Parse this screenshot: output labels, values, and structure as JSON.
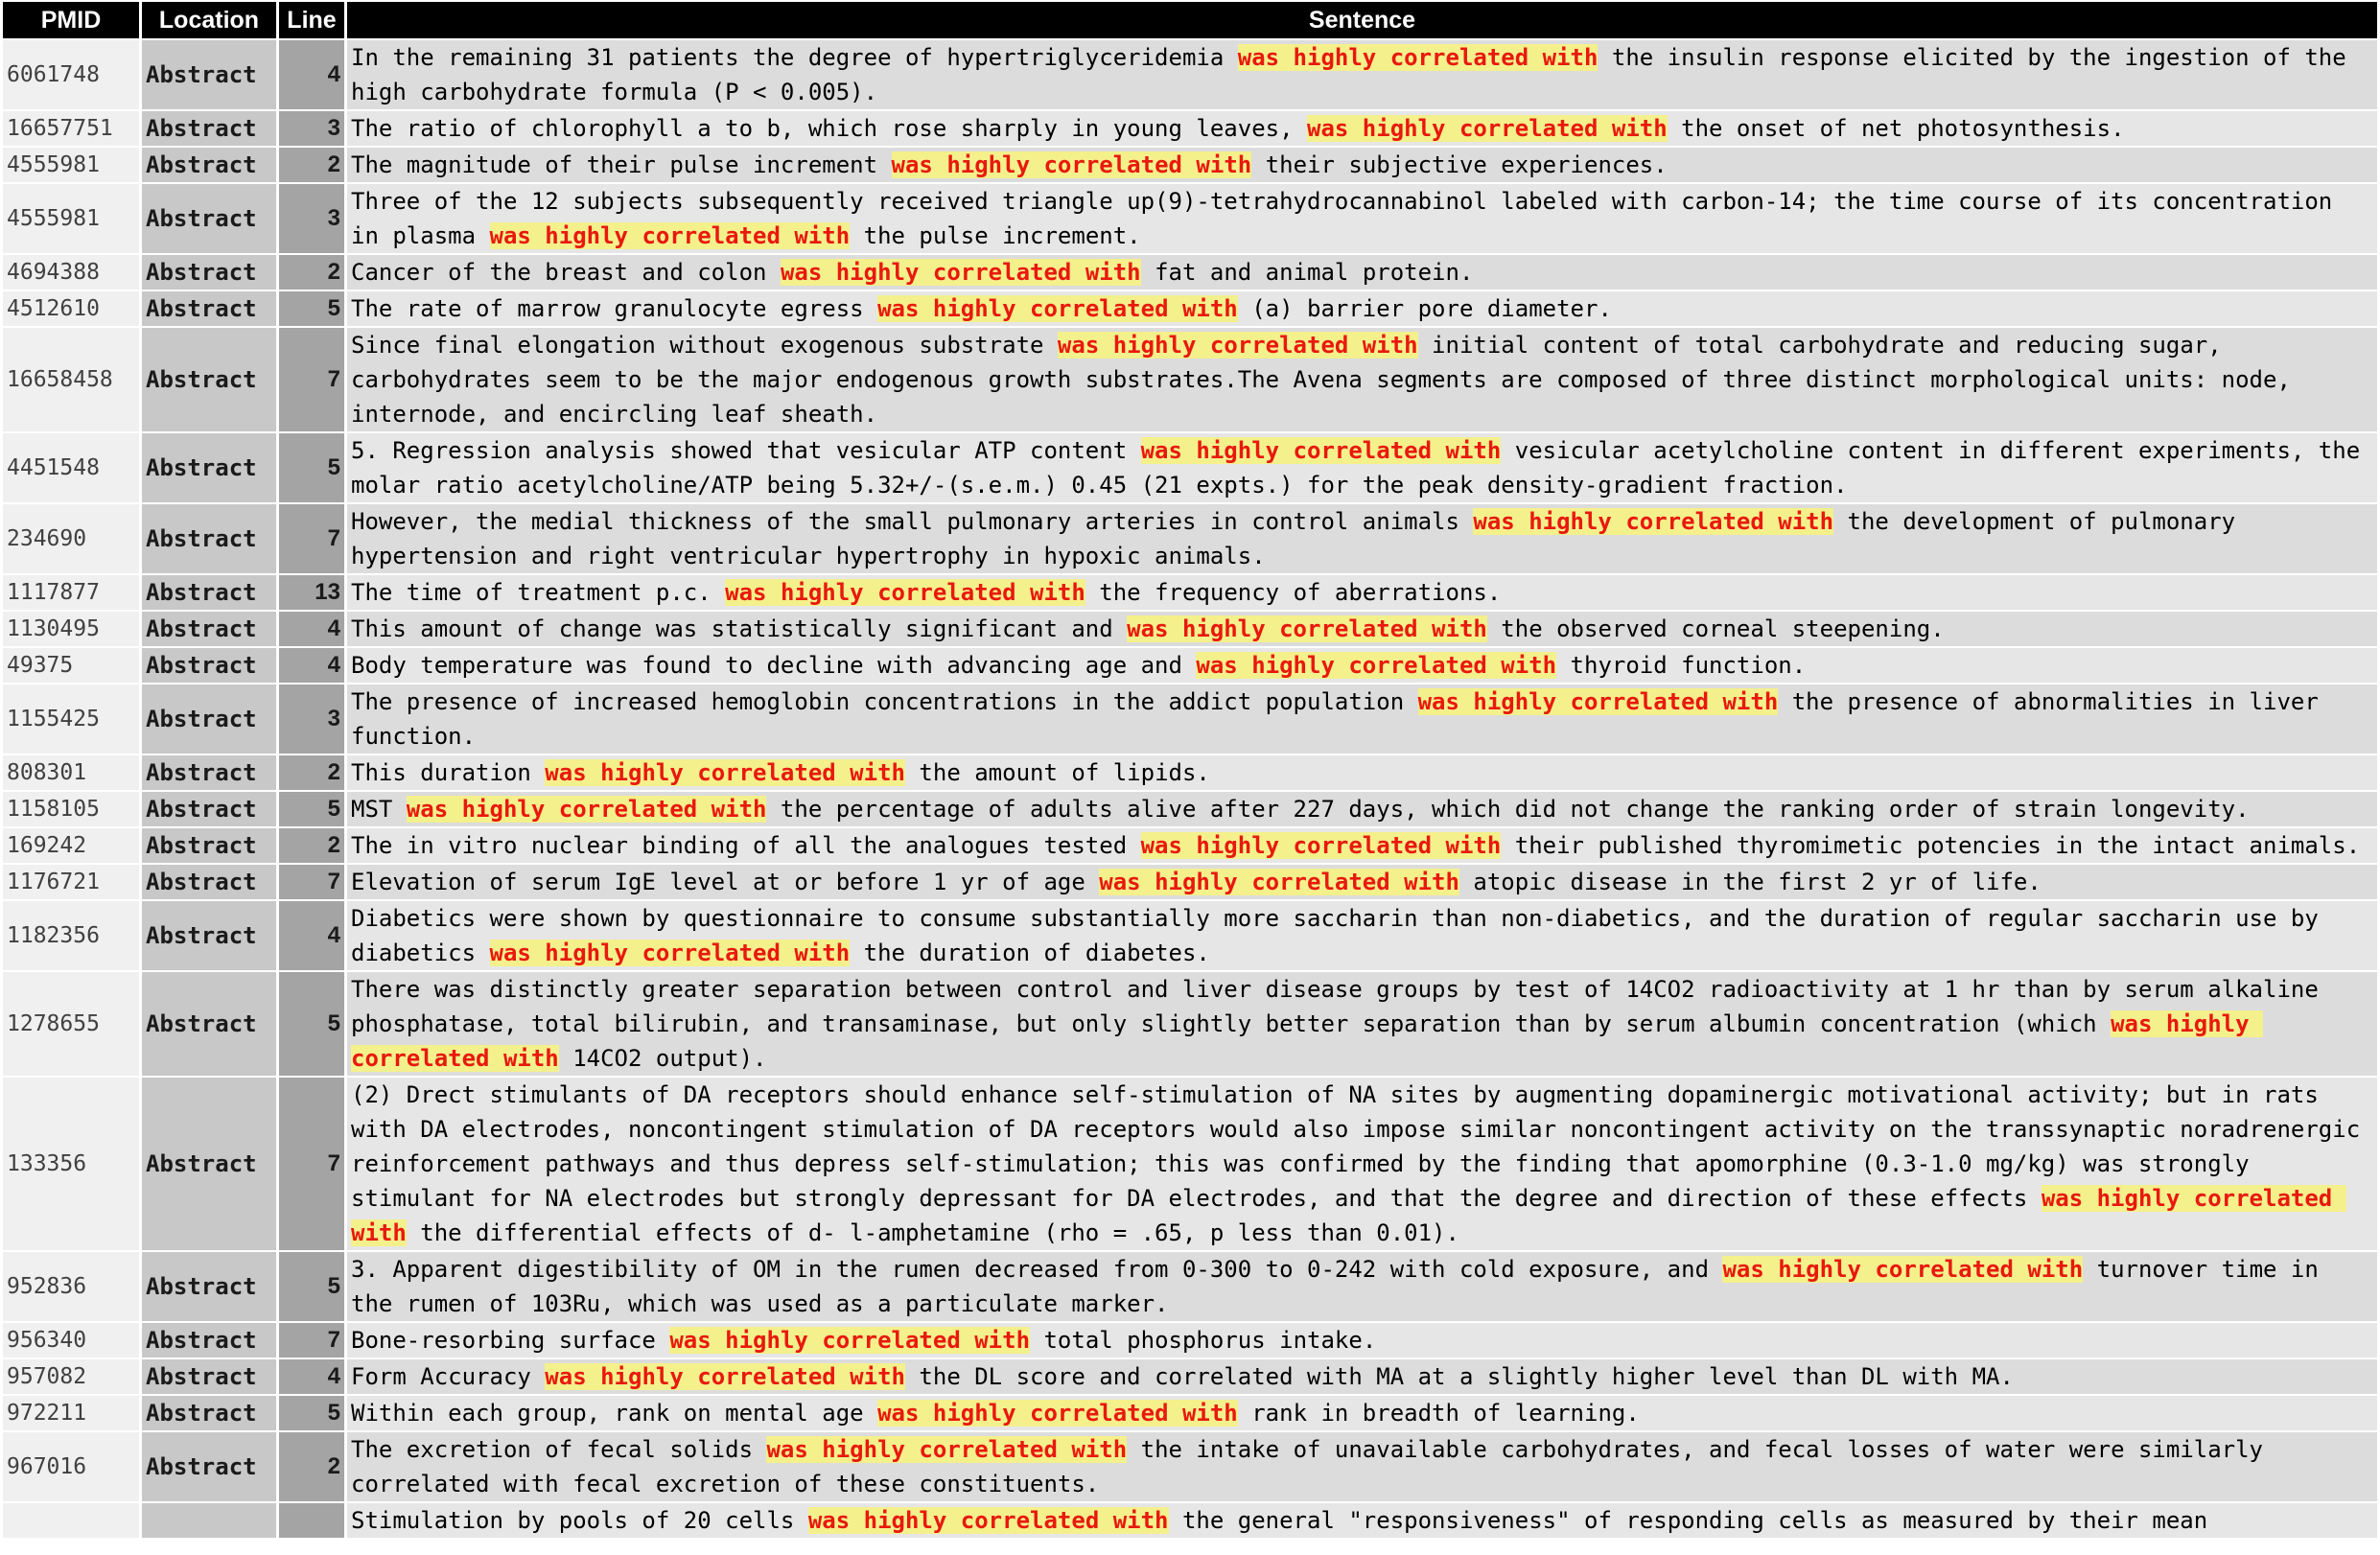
{
  "headers": {
    "pmid": "PMID",
    "location": "Location",
    "line": "Line",
    "sentence": "Sentence"
  },
  "colors": {
    "header_bg": "#000000",
    "highlight_bg": "#f4f08c",
    "highlight_text": "#e8190e"
  },
  "rows": [
    {
      "pmid": "6061748",
      "location": "Abstract",
      "line": "4",
      "before": "In the remaining 31 patients the degree of hypertriglyceridemia ",
      "match": "was highly correlated with",
      "after": " the insulin response elicited by the ingestion of the high carbohydrate formula (P < 0.005)."
    },
    {
      "pmid": "16657751",
      "location": "Abstract",
      "line": "3",
      "before": "The ratio of chlorophyll a to b, which rose sharply in young leaves, ",
      "match": "was highly correlated with",
      "after": " the onset of net photosynthesis."
    },
    {
      "pmid": "4555981",
      "location": "Abstract",
      "line": "2",
      "before": "The magnitude of their pulse increment ",
      "match": "was highly correlated with",
      "after": " their subjective experiences."
    },
    {
      "pmid": "4555981",
      "location": "Abstract",
      "line": "3",
      "before": "Three of the 12 subjects subsequently received triangle up(9)-tetrahydrocannabinol labeled with carbon-14; the time course of its concentration in plasma ",
      "match": "was highly correlated with",
      "after": " the pulse increment."
    },
    {
      "pmid": "4694388",
      "location": "Abstract",
      "line": "2",
      "before": "Cancer of the breast and colon ",
      "match": "was highly correlated with",
      "after": " fat and animal protein."
    },
    {
      "pmid": "4512610",
      "location": "Abstract",
      "line": "5",
      "before": "The rate of marrow granulocyte egress ",
      "match": "was highly correlated with",
      "after": " (a) barrier pore diameter."
    },
    {
      "pmid": "16658458",
      "location": "Abstract",
      "line": "7",
      "before": "Since final elongation without exogenous substrate ",
      "match": "was highly correlated with",
      "after": " initial content of total carbohydrate and reducing sugar, carbohydrates seem to be the major endogenous growth substrates.The Avena segments are composed of three distinct morphological units: node, internode, and encircling leaf sheath."
    },
    {
      "pmid": "4451548",
      "location": "Abstract",
      "line": "5",
      "before": "5. Regression analysis showed that vesicular ATP content ",
      "match": "was highly correlated with",
      "after": " vesicular acetylcholine content in different experiments, the molar ratio acetylcholine/ATP being 5.32+/-(s.e.m.) 0.45 (21 expts.) for the peak density-gradient fraction."
    },
    {
      "pmid": "234690",
      "location": "Abstract",
      "line": "7",
      "before": "However, the medial thickness of the small pulmonary arteries in control animals ",
      "match": "was highly correlated with",
      "after": " the development of pulmonary hypertension and right ventricular hypertrophy in hypoxic animals."
    },
    {
      "pmid": "1117877",
      "location": "Abstract",
      "line": "13",
      "before": "The time of treatment p.c. ",
      "match": "was highly correlated with",
      "after": " the frequency of aberrations."
    },
    {
      "pmid": "1130495",
      "location": "Abstract",
      "line": "4",
      "before": "This amount of change was statistically significant and ",
      "match": "was highly correlated with",
      "after": " the observed corneal steepening."
    },
    {
      "pmid": "49375",
      "location": "Abstract",
      "line": "4",
      "before": "Body temperature was found to decline with advancing age and ",
      "match": "was highly correlated with",
      "after": " thyroid function."
    },
    {
      "pmid": "1155425",
      "location": "Abstract",
      "line": "3",
      "before": "The presence of increased hemoglobin concentrations in the addict population ",
      "match": "was highly correlated with",
      "after": " the presence of abnormalities in liver function."
    },
    {
      "pmid": "808301",
      "location": "Abstract",
      "line": "2",
      "before": "This duration ",
      "match": "was highly correlated with",
      "after": " the amount of lipids."
    },
    {
      "pmid": "1158105",
      "location": "Abstract",
      "line": "5",
      "before": "MST ",
      "match": "was highly correlated with",
      "after": " the percentage of adults alive after 227 days, which did not change the ranking order of strain longevity."
    },
    {
      "pmid": "169242",
      "location": "Abstract",
      "line": "2",
      "before": "The in vitro nuclear binding of all the analogues tested ",
      "match": "was highly correlated with",
      "after": " their published thyromimetic potencies in the intact animals."
    },
    {
      "pmid": "1176721",
      "location": "Abstract",
      "line": "7",
      "before": "Elevation of serum IgE level at or before 1 yr of age ",
      "match": "was highly correlated with",
      "after": " atopic disease in the first 2 yr of life."
    },
    {
      "pmid": "1182356",
      "location": "Abstract",
      "line": "4",
      "before": "Diabetics were shown by questionnaire to consume substantially more saccharin than non-diabetics, and the duration of regular saccharin use by diabetics ",
      "match": "was highly correlated with",
      "after": " the duration of diabetes."
    },
    {
      "pmid": "1278655",
      "location": "Abstract",
      "line": "5",
      "before": "There was distinctly greater separation between control and liver disease groups by test of 14CO2 radioactivity at 1 hr than by serum alkaline phosphatase, total bilirubin, and transaminase, but only slightly better separation than by serum albumin concentration (which ",
      "match": "was highly correlated with",
      "after": " 14CO2 output)."
    },
    {
      "pmid": "133356",
      "location": "Abstract",
      "line": "7",
      "before": "(2) Drect stimulants of DA receptors should enhance self-stimulation of NA sites by augmenting dopaminergic motivational activity; but in rats with DA electrodes, noncontingent stimulation of DA receptors would also impose similar noncontingent activity on the transsynaptic noradrenergic reinforcement pathways and thus depress self-stimulation; this was confirmed by the finding that apomorphine (0.3-1.0 mg/kg) was strongly stimulant for NA electrodes but strongly depressant for DA electrodes, and that the degree and direction of these effects ",
      "match": "was highly correlated with",
      "after": " the differential effects of d- l-amphetamine (rho = .65, p less than 0.01)."
    },
    {
      "pmid": "952836",
      "location": "Abstract",
      "line": "5",
      "before": "3. Apparent digestibility of OM in the rumen decreased from 0-300 to 0-242 with cold exposure, and ",
      "match": "was highly correlated with",
      "after": " turnover time in the rumen of 103Ru, which was used as a particulate marker."
    },
    {
      "pmid": "956340",
      "location": "Abstract",
      "line": "7",
      "before": "Bone-resorbing surface ",
      "match": "was highly correlated with",
      "after": " total phosphorus intake."
    },
    {
      "pmid": "957082",
      "location": "Abstract",
      "line": "4",
      "before": "Form Accuracy ",
      "match": "was highly correlated with",
      "after": " the DL score and correlated with MA at a slightly higher level than DL with MA."
    },
    {
      "pmid": "972211",
      "location": "Abstract",
      "line": "5",
      "before": "Within each group, rank on mental age ",
      "match": "was highly correlated with",
      "after": " rank in breadth of learning."
    },
    {
      "pmid": "967016",
      "location": "Abstract",
      "line": "2",
      "before": "The excretion of fecal solids ",
      "match": "was highly correlated with",
      "after": " the intake of unavailable carbohydrates, and fecal losses of water were similarly correlated with fecal excretion of these constituents."
    },
    {
      "pmid": "",
      "location": "",
      "line": "",
      "before": "Stimulation by pools of 20 cells ",
      "match": "was highly correlated with",
      "after": " the general \"responsiveness\" of responding cells as measured by their mean"
    }
  ]
}
